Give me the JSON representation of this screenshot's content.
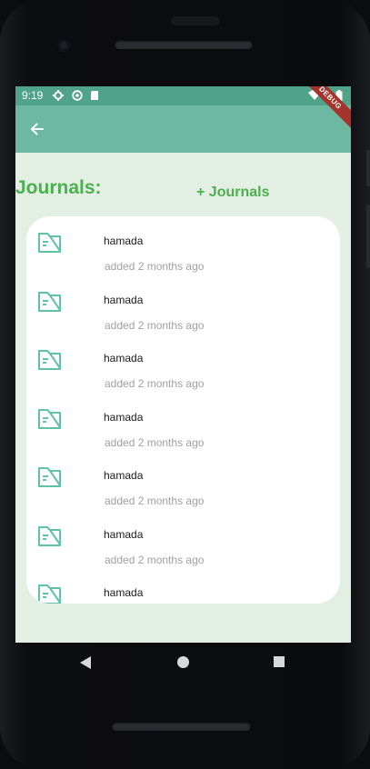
{
  "status": {
    "time": "9:19",
    "debug_badge": "DEBUG"
  },
  "appbar": {
    "back_icon": "arrow-left-icon"
  },
  "page": {
    "heading": "Journals:",
    "add_button_label": "+ Journals"
  },
  "journals": [
    {
      "name": "hamada",
      "added": "added 2 months ago"
    },
    {
      "name": "hamada",
      "added": "added 2 months ago"
    },
    {
      "name": "hamada",
      "added": "added 2 months ago"
    },
    {
      "name": "hamada",
      "added": "added 2 months ago"
    },
    {
      "name": "hamada",
      "added": "added 2 months ago"
    },
    {
      "name": "hamada",
      "added": "added 2 months ago"
    },
    {
      "name": "hamada",
      "added": ""
    }
  ],
  "colors": {
    "accent": "#4caf50",
    "appbar": "#6cb8a1",
    "statusbar": "#50a388",
    "background": "#e3efe2"
  }
}
